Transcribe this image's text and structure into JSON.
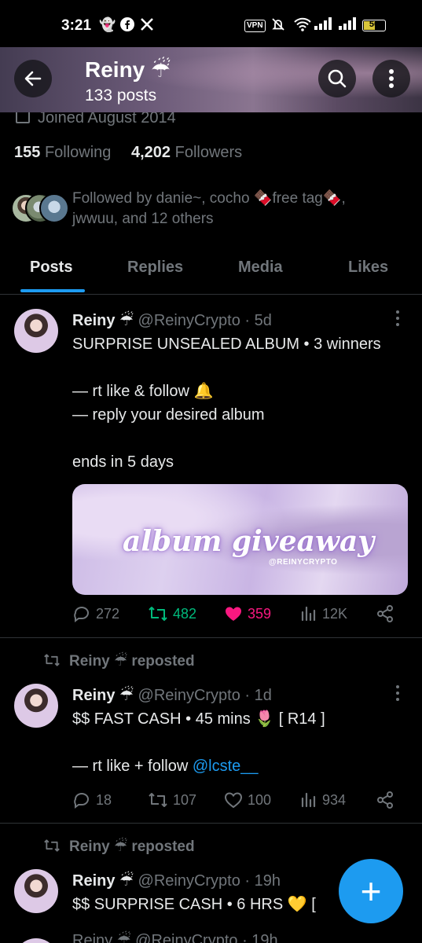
{
  "status_bar": {
    "time": "3:21",
    "vpn": "VPN",
    "battery": "50",
    "app_icons": [
      "snapchat-icon",
      "facebook-icon",
      "x-icon"
    ]
  },
  "header": {
    "name": "Reiny ☔",
    "posts_count": "133 posts"
  },
  "profile": {
    "joined": "Joined August 2014",
    "following_count": "155",
    "following_label": "Following",
    "followers_count": "4,202",
    "followers_label": "Followers",
    "followed_by": "Followed by danie~, cocho 🍫free tag🍫, jwwuu, and 12 others"
  },
  "tabs": [
    "Posts",
    "Replies",
    "Media",
    "Likes"
  ],
  "posts": [
    {
      "name": "Reiny ☔",
      "handle_time": "@ReinyCrypto · 5d",
      "text": "SURPRISE UNSEALED ALBUM • 3 winners\n\n— rt like & follow 🔔\n— reply your desired album\n\nends in 5 days",
      "media_title": "album giveaway",
      "media_sub": "@REINYCRYPTO",
      "replies": "272",
      "reposts": "482",
      "likes": "359",
      "views": "12K"
    },
    {
      "repost_label": "Reiny ☔ reposted",
      "name": "Reiny ☔",
      "handle_time": "@ReinyCrypto · 1d",
      "text": "$$ FAST CASH • 45 mins 🌷 [ R14 ]\n\n— rt like + follow ",
      "mention": "@lcste__",
      "replies": "18",
      "reposts": "107",
      "likes": "100",
      "views": "934"
    },
    {
      "repost_label": "Reiny ☔ reposted",
      "name": "Reiny ☔",
      "handle_time": "@ReinyCrypto · 19h",
      "text": "$$ SURPRISE CASH • 6 HRS 💛  [",
      "next_preview": "Reiny ☔ @ReinyCrypto · 19h"
    }
  ],
  "colors": {
    "accent": "#1d9bf0",
    "repost_green": "#00ba7c",
    "like_pink": "#f91880",
    "muted": "#71767b",
    "background": "#000000"
  }
}
